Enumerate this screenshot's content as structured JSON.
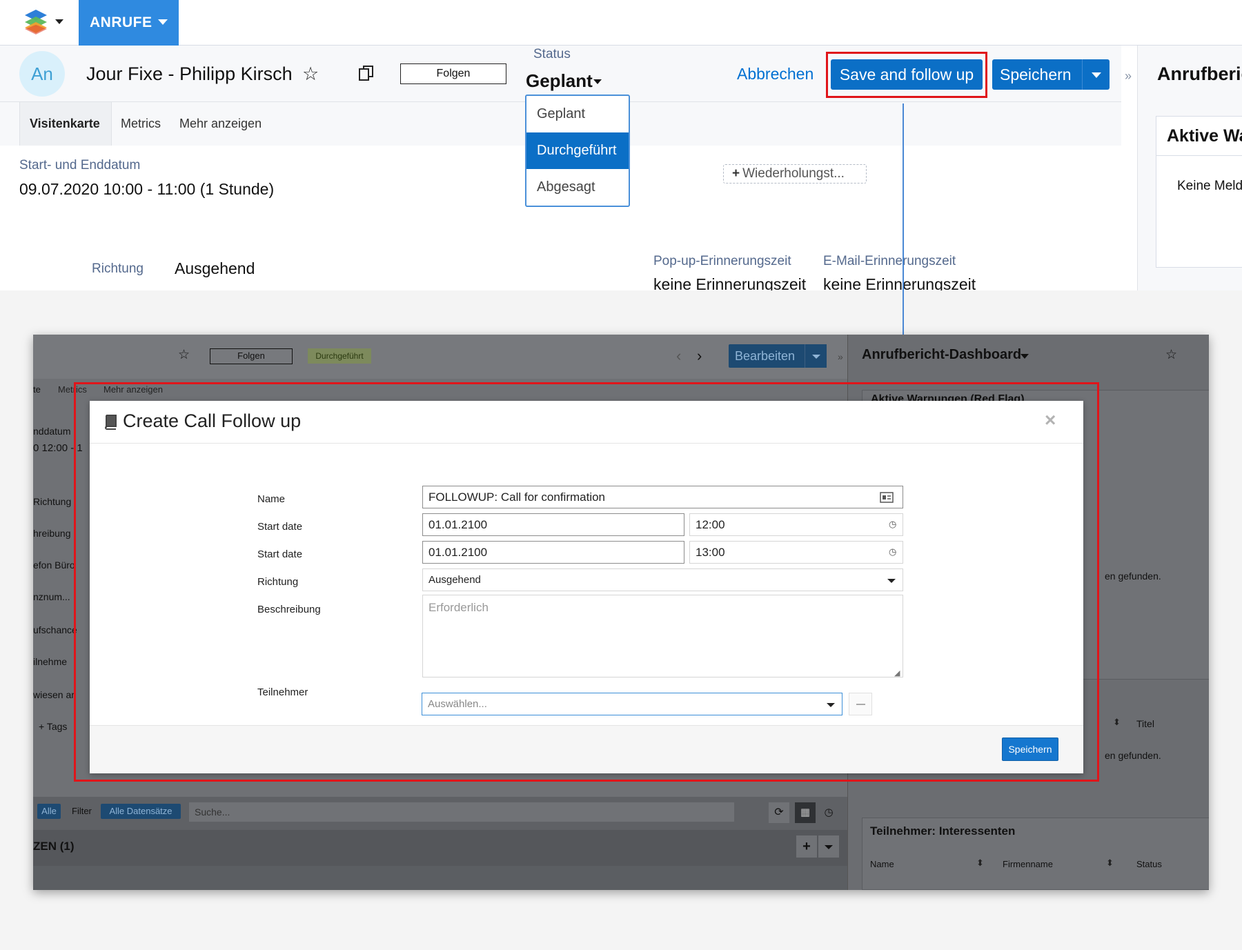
{
  "top": {
    "nav": {
      "tab_label": "ANRUFE"
    },
    "header": {
      "avatar_initials": "An",
      "record_title": "Jour Fixe - Philipp Kirsch",
      "follow_label": "Folgen",
      "status_label": "Status",
      "status_value": "Geplant",
      "cancel_label": "Abbrechen",
      "save_follow_label": "Save and follow up",
      "save_label": "Speichern"
    },
    "status_options": [
      "Geplant",
      "Durchgeführt",
      "Abgesagt"
    ],
    "status_selected": "Durchgeführt",
    "tabs": [
      "Visitenkarte",
      "Metrics",
      "Mehr anzeigen"
    ],
    "fields": {
      "date_label": "Start- und Enddatum",
      "date_value": "09.07.2020 10:00 - 11:00 (1 Stunde)",
      "repeat_label": "Wiederholungst...",
      "direction_label": "Richtung",
      "direction_value": "Ausgehend",
      "popup_label": "Pop-up-Erinnerungszeit",
      "popup_value": "keine Erinnerungszeit",
      "email_label": "E-Mail-Erinnerungszeit",
      "email_value": "keine Erinnerungszeit"
    },
    "right_panel": {
      "title": "Anrufberic",
      "card_title": "Aktive Wa",
      "card_text": "Keine Meld"
    }
  },
  "bottom": {
    "header": {
      "follow_label": "Folgen",
      "status_badge": "Durchgeführt",
      "edit_label": "Bearbeiten"
    },
    "tabs": [
      "te",
      "Metrics",
      "Mehr anzeigen"
    ],
    "side_labels": [
      "nddatum",
      "0 12:00 - 1",
      "Richtung",
      "hreibung",
      "efon Büro",
      "nznum...",
      "ufschance",
      "ilnehme",
      "wiesen ar",
      "+ Tags"
    ],
    "list_bar": {
      "all_label": "Alle",
      "filter_label": "Filter",
      "all_records_label": "Alle Datensätze",
      "search_placeholder": "Suche..."
    },
    "section_title": "ZEN (1)",
    "right_panel": {
      "title": "Anrufbericht-Dashboard",
      "card_partial": "Aktive Warnungen (Red Flag)",
      "no_found_1": "en gefunden.",
      "col_titel": "Titel",
      "no_found_2": "en gefunden.",
      "participants_title": "Teilnehmer: Interessenten",
      "col_name": "Name",
      "col_firm": "Firmenname",
      "col_status": "Status"
    },
    "modal": {
      "title": "Create Call Follow up",
      "name_label": "Name",
      "name_value": "FOLLOWUP: Call for confirmation",
      "start_label_1": "Start date",
      "start_date_1": "01.01.2100",
      "start_time_1": "12:00",
      "start_label_2": "Start date",
      "start_date_2": "01.01.2100",
      "start_time_2": "13:00",
      "direction_label": "Richtung",
      "direction_value": "Ausgehend",
      "description_label": "Beschreibung",
      "description_placeholder": "Erforderlich",
      "participants_label": "Teilnehmer",
      "participants_placeholder": "Auswählen...",
      "save_label": "Speichern"
    }
  },
  "colors": {
    "accent_blue": "#0b6fc6",
    "nav_blue": "#2f8ae0",
    "highlight_red": "#e0151a"
  },
  "icons": [
    "app-logo-icon",
    "star-icon",
    "copy-icon",
    "chevron-down-icon",
    "plus-icon",
    "collapse-icon",
    "book-icon",
    "close-icon",
    "id-card-icon",
    "clock-icon",
    "refresh-icon",
    "grid-icon",
    "minus-icon"
  ]
}
